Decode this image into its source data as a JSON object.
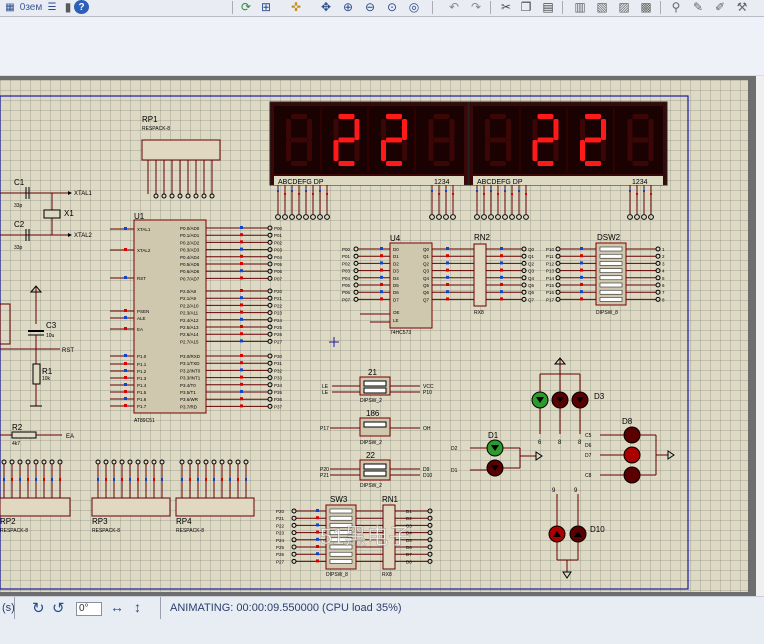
{
  "toolbar": {
    "icons": [
      "zoom-select-icon",
      "wire-autorouter-icon",
      "snap-grid-icon",
      "origin-icon",
      "pan-icon",
      "zoom-in-icon",
      "zoom-out-icon",
      "zoom-all-icon",
      "zoom-area-icon",
      "undo-icon",
      "redo-icon",
      "cut-icon",
      "copy-icon",
      "paste-icon",
      "block-copy-icon",
      "block-move-icon",
      "block-rotate-icon",
      "block-delete-icon",
      "pick-device-icon",
      "make-device-icon",
      "packaging-icon"
    ],
    "badge_text": "0зем"
  },
  "schematic": {
    "u1": {
      "ref": "U1",
      "part": "AT89C51",
      "text": "<TEXT>",
      "left_pins": [
        "XTAL1",
        "XTAL2",
        "RST",
        "PSEN",
        "ALE",
        "EA",
        "P1.0",
        "P1.1",
        "P1.2",
        "P1.3",
        "P1.4",
        "P1.5",
        "P1.6",
        "P1.7"
      ],
      "right_pins": [
        "P0.0/AD0",
        "P0.1/AD1",
        "P0.2/AD2",
        "P0.3/AD3",
        "P0.4/AD4",
        "P0.5/AD5",
        "P0.6/AD6",
        "P0.7/AD7",
        "P2.0/A8",
        "P2.1/A9",
        "P2.2/A10",
        "P2.3/A11",
        "P2.4/A12",
        "P2.5/A13",
        "P2.6/A14",
        "P2.7/A15",
        "P3.0/RXD",
        "P3.1/TXD",
        "P3.2/INT0",
        "P3.3/INT1",
        "P3.4/T0",
        "P3.5/T1",
        "P3.6/WR",
        "P3.7/RD"
      ],
      "right_nets": [
        "P00",
        "P01",
        "P02",
        "P03",
        "P04",
        "P05",
        "P06",
        "P07",
        "P20",
        "P21",
        "P22",
        "P23",
        "P24",
        "P25",
        "P26",
        "P27",
        "P30",
        "P31",
        "P32",
        "P33",
        "P34",
        "P35",
        "P36",
        "P37"
      ]
    },
    "u4": {
      "ref": "U4",
      "part": "74HC573",
      "text": "<TEXT>",
      "left_pins": [
        "D0",
        "D1",
        "D2",
        "D3",
        "D4",
        "D5",
        "D6",
        "D7",
        "OE",
        "LE"
      ],
      "right_pins": [
        "Q0",
        "Q1",
        "Q2",
        "Q3",
        "Q4",
        "Q5",
        "Q6",
        "Q7"
      ],
      "left_nets": [
        "P00",
        "P01",
        "P02",
        "P03",
        "P04",
        "P05",
        "P06",
        "P07"
      ],
      "right_nets": [
        "Q0",
        "Q1",
        "Q2",
        "Q3",
        "Q4",
        "Q5",
        "Q6",
        "Q7"
      ]
    },
    "display1": {
      "digits": [
        "",
        "2",
        "2",
        ""
      ],
      "pin_label_left": "ABCDEFG DP",
      "pin_label_right": "1234"
    },
    "display2": {
      "digits": [
        "",
        "2",
        "2",
        ""
      ],
      "pin_label_left": "ABCDEFG DP",
      "pin_label_right": "1234"
    },
    "components": {
      "rp1": "RP1",
      "rp1_part": "RESPACK-8",
      "x1": "X1",
      "c1": "C1",
      "c2": "C2",
      "c1_val": "33p",
      "c2_val": "33p",
      "c3": "C3",
      "c3_val": "10u",
      "r1": "R1",
      "r1_val": "10k",
      "r2": "R2",
      "r2_val": "4k7",
      "rst": "RST",
      "ea": "EA",
      "xtal1": "XTAL1",
      "xtal2": "XTAL2",
      "rn2": "RN2",
      "rn1": "RN1",
      "rx8": "RX8",
      "dsw2": "DSW2",
      "dsw_part": "DIPSW_8",
      "sw21": "21",
      "sw186": "186",
      "sw22": "22",
      "dipsw_2": "DIPSW_2",
      "sw3": "SW3",
      "d1": "D1",
      "d3": "D3",
      "d8": "D8",
      "d10": "D10",
      "rp2": "RP2",
      "rp3": "RP3",
      "rp4": "RP4",
      "respack": "RESPACK-8",
      "text_tag": "<TEXT>",
      "watermark": "51黑电子"
    },
    "nets": {
      "sw21_left": [
        "LE",
        "LE"
      ],
      "sw21_right": [
        "VCC",
        "P10"
      ],
      "sw186_left": [
        "P17"
      ],
      "sw186_right": [
        "OH"
      ],
      "sw22_left": [
        "P20",
        "P21"
      ],
      "sw22_right": [
        "D9",
        "D10"
      ],
      "d1_left": [
        "D2",
        "D1"
      ],
      "d8_left": [
        "C5",
        "D6",
        "D7",
        "C8"
      ],
      "dsw2_left": [
        "P10",
        "P11",
        "P12",
        "P13",
        "P14",
        "P15",
        "P16",
        "P17"
      ],
      "rn2_right": [
        "Q0",
        "Q1",
        "Q2",
        "Q3",
        "Q4",
        "Q5",
        "Q6",
        "Q7"
      ],
      "sw3_left": [
        "P20",
        "P21",
        "P22",
        "P23",
        "P24",
        "P25",
        "P26",
        "P27"
      ],
      "rn1_right": [
        "D1",
        "D2",
        "D3",
        "D4",
        "D5",
        "D6",
        "D7",
        "D8"
      ],
      "d3_bottom": [
        "6",
        "8",
        "8"
      ],
      "d10_top": [
        "9",
        "9"
      ]
    }
  },
  "statusbar": {
    "partial_label": "(s)",
    "rotation_value": "0°",
    "status_text": "ANIMATING: 00:00:09.550000 (CPU load 35%)"
  }
}
